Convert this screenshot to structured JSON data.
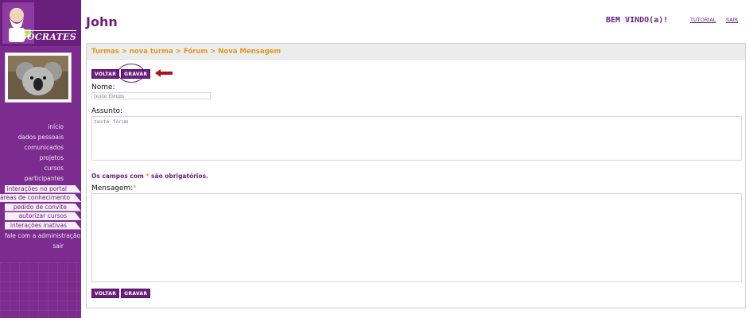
{
  "app": {
    "brand": "SÓCRATES"
  },
  "header": {
    "title": "John",
    "welcome": "BEM VINDO(a)!",
    "tutorial_label": "TUTORIAL",
    "logout_label": "SAIR"
  },
  "sidebar": {
    "items": [
      {
        "label": "início"
      },
      {
        "label": "dados pessoais"
      },
      {
        "label": "comunicados"
      },
      {
        "label": "projetos"
      },
      {
        "label": "cursos"
      },
      {
        "label": "participantes"
      },
      {
        "label": "interações no portal"
      },
      {
        "label": "áreas de conhecimento"
      },
      {
        "label": "pedido de convite"
      },
      {
        "label": "autorizar cursos"
      },
      {
        "label": "interações inativas"
      },
      {
        "label": "fale com a administração"
      },
      {
        "label": "sair"
      }
    ]
  },
  "breadcrumb": "Turmas > nova turma > Fórum > Nova Mensagem",
  "buttons": {
    "back": "VOLTAR",
    "save": "GRAVAR"
  },
  "form": {
    "name_label": "Nome:",
    "name_value": "teste fórum",
    "subject_label": "Assunto:",
    "subject_value": "teste fórum",
    "required_note_prefix": "Os campos com",
    "required_star": "*",
    "required_note_suffix": "são obrigatórios.",
    "message_label": "Mensagem:",
    "message_value": ""
  },
  "colors": {
    "primary": "#6a1f7d",
    "accent": "#e09a20",
    "sidebar": "#7b2c8e"
  }
}
